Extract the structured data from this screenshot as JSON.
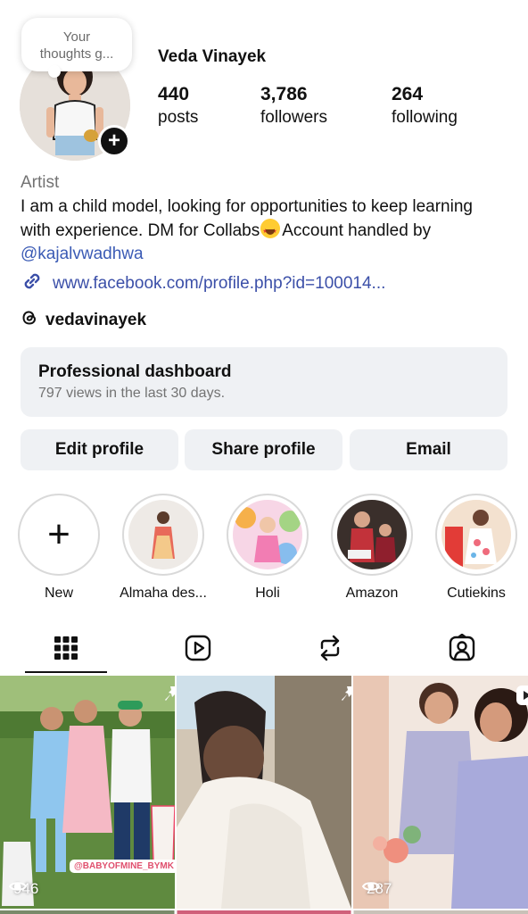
{
  "profile": {
    "note": "Your thoughts g...",
    "username": "Veda Vinayek",
    "category": "Artist",
    "bio_line": "I am a child model, looking for opportunities to keep learning with experience. DM for Collabs",
    "bio_tail": "Account handled by ",
    "mention": "@kajalvwadhwa",
    "link": "www.facebook.com/profile.php?id=100014...",
    "threads_handle": "vedavinayek"
  },
  "stats": [
    {
      "value": "440",
      "label": "posts"
    },
    {
      "value": "3,786",
      "label": "followers"
    },
    {
      "value": "264",
      "label": "following"
    }
  ],
  "dashboard": {
    "title": "Professional dashboard",
    "subtitle": "797 views in the last 30 days."
  },
  "buttons": {
    "edit": "Edit profile",
    "share": "Share profile",
    "email": "Email"
  },
  "highlights": [
    {
      "label": "New",
      "icon": "plus-icon"
    },
    {
      "label": "Almaha des..."
    },
    {
      "label": "Holi"
    },
    {
      "label": "Amazon"
    },
    {
      "label": "Cutiekins"
    }
  ],
  "tabs": [
    {
      "icon": "grid-icon",
      "active": true
    },
    {
      "icon": "reels-icon"
    },
    {
      "icon": "reposts-icon"
    },
    {
      "icon": "tagged-icon"
    }
  ],
  "posts": [
    {
      "views": "946",
      "pinned": true,
      "tag": "@BABYOFMINE_BYMK"
    },
    {
      "pinned": true
    },
    {
      "views": "287",
      "reel": true
    }
  ],
  "colors": {
    "accent_link": "#3b4fa8",
    "button_bg": "#eff1f4",
    "muted_text": "#737373"
  }
}
